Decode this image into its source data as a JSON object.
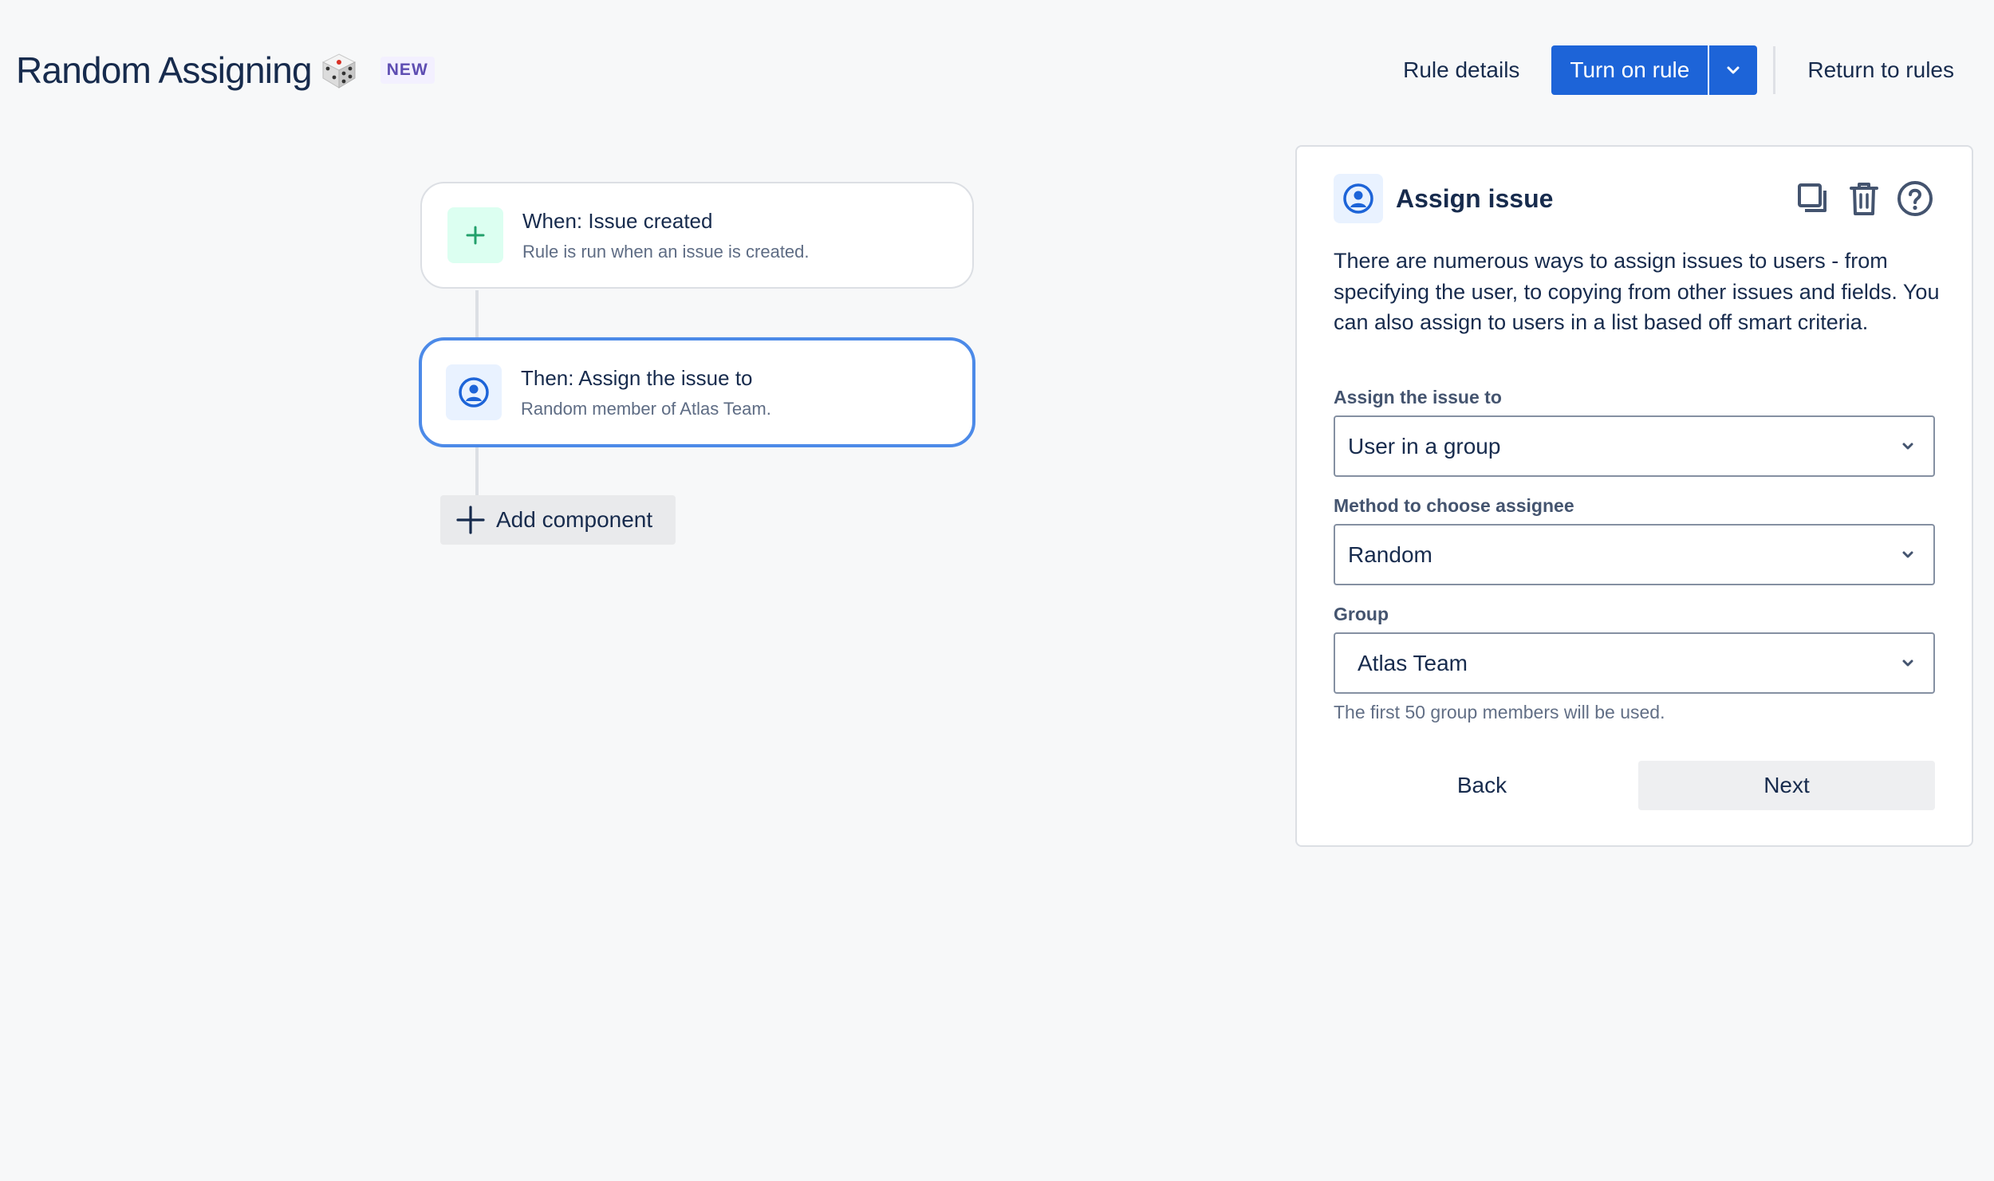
{
  "header": {
    "title": "Random Assigning",
    "title_icon": "dice-icon",
    "lozenge": "NEW",
    "rule_details_label": "Rule details",
    "turn_on_label": "Turn on rule",
    "return_label": "Return to rules"
  },
  "flow": {
    "trigger": {
      "icon": "plus-icon",
      "title": "When: Issue created",
      "subtitle": "Rule is run when an issue is created."
    },
    "action": {
      "icon": "user-avatar-icon",
      "title": "Then: Assign the issue to",
      "subtitle": "Random member of Atlas Team."
    },
    "add_component_label": "Add component"
  },
  "panel": {
    "title": "Assign issue",
    "description": "There are numerous ways to assign issues to users - from specifying the user, to copying from other issues and fields. You can also assign to users in a list based off smart criteria.",
    "fields": [
      {
        "label": "Assign the issue to",
        "value": "User in a group"
      },
      {
        "label": "Method to choose assignee",
        "value": "Random"
      },
      {
        "label": "Group",
        "value": "Atlas Team"
      }
    ],
    "helper": "The first 50 group members will be used.",
    "back_label": "Back",
    "next_label": "Next"
  },
  "colors": {
    "primary": "#1d64d8",
    "selected_border": "#4c8ae8",
    "trigger_icon_bg": "#dcfff1",
    "trigger_icon": "#22a06b",
    "action_icon_bg": "#e9f2ff",
    "lozenge_text": "#5e4db2"
  }
}
